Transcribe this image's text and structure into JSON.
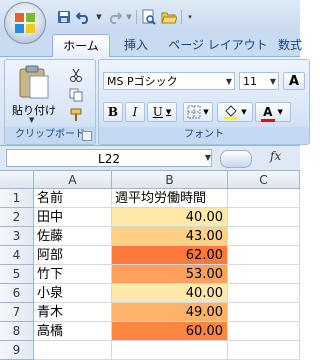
{
  "tabs": [
    "ホーム",
    "挿入",
    "ページ レイアウト",
    "数式"
  ],
  "ribbon": {
    "paste_label": "貼り付け",
    "clipboard_label": "クリップボード",
    "font_label": "フォント",
    "font_name": "MS Pゴシック",
    "font_size": "11",
    "bold": "B",
    "italic": "I",
    "underline": "U",
    "grow_font": "A",
    "font_color_letter": "A"
  },
  "formula_bar": {
    "name_box": "L22",
    "fx": "fx"
  },
  "sheet": {
    "columns": [
      "A",
      "B",
      "C"
    ],
    "rows": [
      {
        "n": "1",
        "a": "名前",
        "b": "週平均労働時間",
        "fill": ""
      },
      {
        "n": "2",
        "a": "田中",
        "b": "40.00",
        "fill": "#ffe8a8"
      },
      {
        "n": "3",
        "a": "佐藤",
        "b": "43.00",
        "fill": "#ffd085"
      },
      {
        "n": "4",
        "a": "阿部",
        "b": "62.00",
        "fill": "#ff7a3a"
      },
      {
        "n": "5",
        "a": "竹下",
        "b": "53.00",
        "fill": "#ffa15c"
      },
      {
        "n": "6",
        "a": "小泉",
        "b": "40.00",
        "fill": "#ffe8a8"
      },
      {
        "n": "7",
        "a": "青木",
        "b": "49.00",
        "fill": "#ffb36a"
      },
      {
        "n": "8",
        "a": "高橋",
        "b": "60.00",
        "fill": "#ff8543"
      },
      {
        "n": "9",
        "a": "",
        "b": "",
        "fill": ""
      }
    ]
  }
}
